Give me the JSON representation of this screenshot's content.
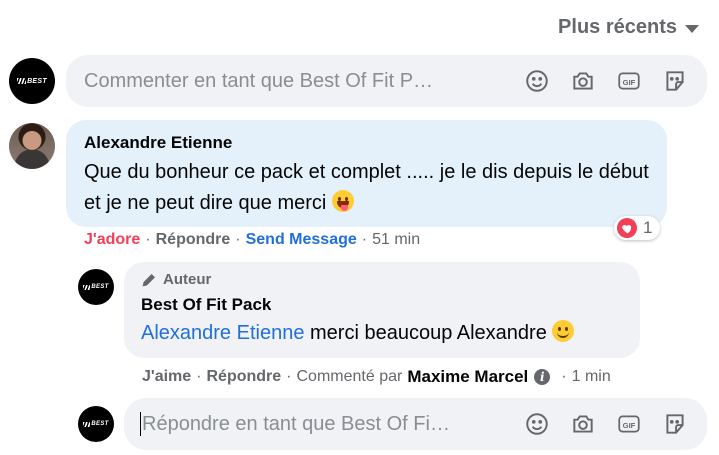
{
  "sort": {
    "label": "Plus récents"
  },
  "composer_top": {
    "placeholder": "Commenter en tant que Best Of Fit P…",
    "avatar_text": "BEST"
  },
  "comment": {
    "author": "Alexandre Etienne",
    "text": "Que du bonheur ce pack et complet ..... je le dis depuis le début et je ne peut dire que merci",
    "emoji": "winking-tongue-emoji",
    "reaction_count": "1",
    "actions": {
      "love": "J'adore",
      "reply": "Répondre",
      "send_message": "Send Message",
      "time": "51 min"
    }
  },
  "reply": {
    "badge": "Auteur",
    "author": "Best Of Fit Pack",
    "mention": "Alexandre Etienne",
    "text": " merci beaucoup Alexandre",
    "emoji": "smiling-emoji",
    "avatar_text": "BEST",
    "actions": {
      "like": "J'aime",
      "reply": "Répondre",
      "commented_by": "Commenté par",
      "commenter": "Maxime Marcel",
      "time": "1 min"
    }
  },
  "composer_reply": {
    "placeholder": "Répondre en tant que Best Of Fi…",
    "avatar_text": "BEST"
  },
  "icons": [
    "emoji-icon",
    "camera-icon",
    "gif-icon",
    "sticker-icon"
  ],
  "colors": {
    "link_blue": "#216fdb",
    "love_red": "#f33e58",
    "muted": "#65676b",
    "bubble": "#f0f2f5",
    "bubble_highlight": "#e4f1fb"
  }
}
